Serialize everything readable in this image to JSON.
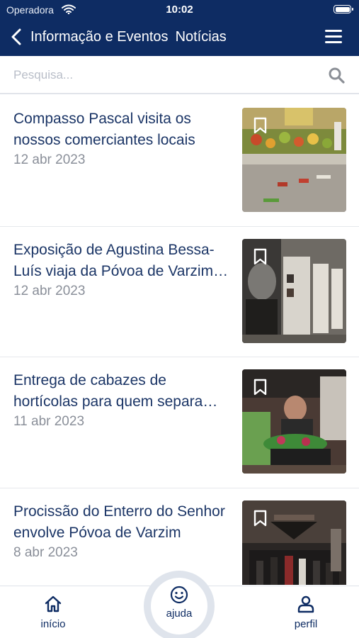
{
  "status_bar": {
    "carrier": "Operadora",
    "time": "10:02"
  },
  "header": {
    "title": "Informação e Eventos",
    "subtitle": "Notícias"
  },
  "search": {
    "placeholder": "Pesquisa..."
  },
  "news": [
    {
      "title_lines": [
        "Compasso Pascal visita os",
        "nossos comerciantes locais"
      ],
      "date": "12 abr 2023"
    },
    {
      "title_lines": [
        "Exposição de Agustina Bessa-",
        "Luís viaja da Póvoa de Varzim…"
      ],
      "date": "12 abr 2023"
    },
    {
      "title_lines": [
        "Entrega de cabazes de",
        "hortícolas para quem separa…"
      ],
      "date": "11 abr 2023"
    },
    {
      "title_lines": [
        "Procissão do Enterro do Senhor",
        "envolve Póvoa de Varzim"
      ],
      "date": "8 abr 2023"
    }
  ],
  "tabbar": {
    "home_label": "início",
    "help_label": "ajuda",
    "profile_label": "perfil"
  },
  "colors": {
    "primary": "#0e2c63",
    "text": "#1b3566",
    "date": "#8a8f99"
  }
}
